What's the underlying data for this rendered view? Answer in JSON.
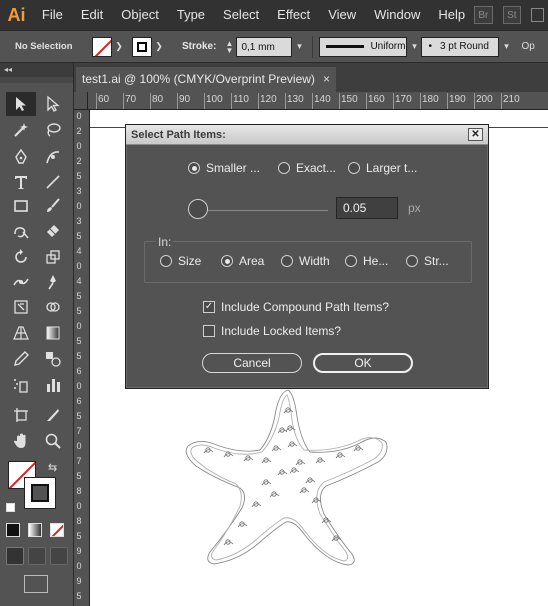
{
  "app": {
    "logo": "Ai",
    "bridge": "Br",
    "stock": "St"
  },
  "menu": [
    "File",
    "Edit",
    "Object",
    "Type",
    "Select",
    "Effect",
    "View",
    "Window",
    "Help"
  ],
  "control": {
    "selection": "No Selection",
    "stroke_label": "Stroke:",
    "stroke_value": "0,1 mm",
    "profile": "Uniform",
    "brush": "3 pt Round",
    "tail": "Op"
  },
  "document": {
    "tab_title": "test1.ai @ 100% (CMYK/Overprint Preview)",
    "close": "×",
    "ruler_h": [
      "60",
      "70",
      "80",
      "90",
      "100",
      "110",
      "120",
      "130",
      "140",
      "150",
      "160",
      "170",
      "180",
      "190",
      "200",
      "210"
    ],
    "ruler_v": [
      "0",
      "2",
      "0",
      "2",
      "5",
      "3",
      "0",
      "3",
      "5",
      "4",
      "0",
      "4",
      "5",
      "5",
      "0",
      "5",
      "5",
      "6",
      "0",
      "6",
      "5",
      "7",
      "0",
      "7",
      "5",
      "8",
      "0",
      "8",
      "5",
      "9",
      "0",
      "9",
      "5"
    ]
  },
  "toolbar": {
    "collapse": "◂◂"
  },
  "dialog": {
    "title": "Select Path Items:",
    "close": "✕",
    "mode_options": [
      {
        "label": "Smaller ...",
        "selected": true
      },
      {
        "label": "Exact...",
        "selected": false
      },
      {
        "label": "Larger t...",
        "selected": false
      }
    ],
    "slider_value": 0.05,
    "value": "0.05",
    "unit": "px",
    "in_label": "In:",
    "in_options": [
      {
        "label": "Size",
        "selected": false
      },
      {
        "label": "Area",
        "selected": true
      },
      {
        "label": "Width",
        "selected": false
      },
      {
        "label": "He...",
        "selected": false
      },
      {
        "label": "Str...",
        "selected": false
      }
    ],
    "include_compound": {
      "label": "Include Compound Path Items?",
      "checked": true
    },
    "include_locked": {
      "label": "Include Locked Items?",
      "checked": false
    },
    "cancel": "Cancel",
    "ok": "OK"
  }
}
